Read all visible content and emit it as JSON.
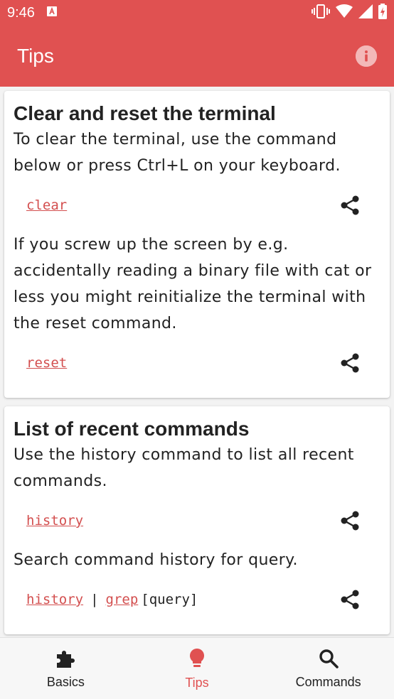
{
  "status_bar": {
    "time": "9:46"
  },
  "app_bar": {
    "title": "Tips",
    "info_icon": "info-icon"
  },
  "cards": [
    {
      "title": "Clear and reset the terminal",
      "blocks": [
        {
          "text": "To clear the terminal, use the command below or press Ctrl+L on your keyboard.",
          "command": [
            "clear"
          ]
        },
        {
          "text": "If you screw up the screen by e.g. accidentally reading a binary file with cat or less you might reinitialize the terminal with the reset command.",
          "command": [
            "reset"
          ]
        }
      ]
    },
    {
      "title": "List of recent commands",
      "blocks": [
        {
          "text": "Use the history command to list all recent commands.",
          "command": [
            "history"
          ]
        },
        {
          "text": "Search command history for query.",
          "command": [
            "history",
            "|",
            "grep",
            "[query]"
          ]
        }
      ]
    }
  ],
  "bottom_nav": {
    "items": [
      {
        "label": "Basics",
        "icon": "puzzle-icon"
      },
      {
        "label": "Tips",
        "icon": "lightbulb-icon",
        "active": true
      },
      {
        "label": "Commands",
        "icon": "search-icon"
      }
    ]
  },
  "colors": {
    "primary": "#e05151",
    "link": "#d34f4f",
    "text": "#222222"
  }
}
